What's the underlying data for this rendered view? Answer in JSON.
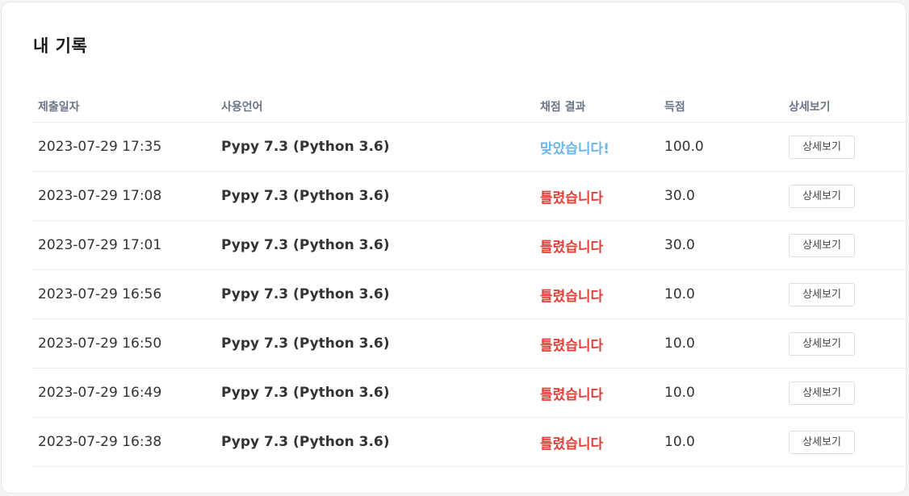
{
  "page": {
    "title": "내 기록"
  },
  "table": {
    "headers": {
      "date": "제출일자",
      "language": "사용언어",
      "result": "채점 결과",
      "score": "득점",
      "detail": "상세보기"
    },
    "rows": [
      {
        "date": "2023-07-29 17:35",
        "language": "Pypy 7.3 (Python 3.6)",
        "result": "맞았습니다!",
        "result_color": "#6ab7e8",
        "score": "100.0",
        "detail_label": "상세보기"
      },
      {
        "date": "2023-07-29 17:08",
        "language": "Pypy 7.3 (Python 3.6)",
        "result": "틀렸습니다",
        "result_color": "#e0413a",
        "score": "30.0",
        "detail_label": "상세보기"
      },
      {
        "date": "2023-07-29 17:01",
        "language": "Pypy 7.3 (Python 3.6)",
        "result": "틀렸습니다",
        "result_color": "#e0413a",
        "score": "30.0",
        "detail_label": "상세보기"
      },
      {
        "date": "2023-07-29 16:56",
        "language": "Pypy 7.3 (Python 3.6)",
        "result": "틀렸습니다",
        "result_color": "#e0413a",
        "score": "10.0",
        "detail_label": "상세보기"
      },
      {
        "date": "2023-07-29 16:50",
        "language": "Pypy 7.3 (Python 3.6)",
        "result": "틀렸습니다",
        "result_color": "#e0413a",
        "score": "10.0",
        "detail_label": "상세보기"
      },
      {
        "date": "2023-07-29 16:49",
        "language": "Pypy 7.3 (Python 3.6)",
        "result": "틀렸습니다",
        "result_color": "#e0413a",
        "score": "10.0",
        "detail_label": "상세보기"
      },
      {
        "date": "2023-07-29 16:38",
        "language": "Pypy 7.3 (Python 3.6)",
        "result": "틀렸습니다",
        "result_color": "#e0413a",
        "score": "10.0",
        "detail_label": "상세보기"
      }
    ]
  }
}
